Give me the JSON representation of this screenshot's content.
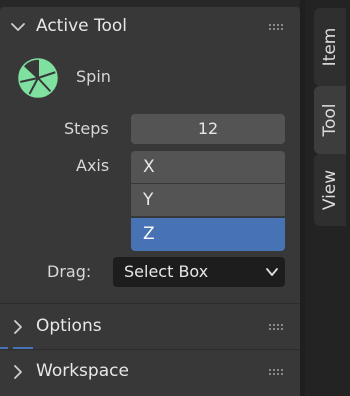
{
  "panels": {
    "active_tool": {
      "title": "Active Tool",
      "expanded": true
    },
    "options": {
      "title": "Options",
      "expanded": false
    },
    "workspace": {
      "title": "Workspace",
      "expanded": false
    }
  },
  "tool": {
    "name": "Spin",
    "icon": "spin-tool-icon",
    "icon_color": "#7fe0a0"
  },
  "properties": {
    "steps": {
      "label": "Steps",
      "value": "12"
    },
    "axis": {
      "label": "Axis",
      "options": [
        "X",
        "Y",
        "Z"
      ],
      "selected": "Z"
    },
    "drag": {
      "label": "Drag:",
      "value": "Select Box"
    }
  },
  "side_tabs": [
    {
      "label": "Item",
      "active": false
    },
    {
      "label": "Tool",
      "active": true
    },
    {
      "label": "View",
      "active": false
    }
  ],
  "colors": {
    "panel_bg": "#383838",
    "field_bg": "#545454",
    "selected_accent": "#4772b3",
    "dropdown_bg": "#1d1d1d"
  }
}
